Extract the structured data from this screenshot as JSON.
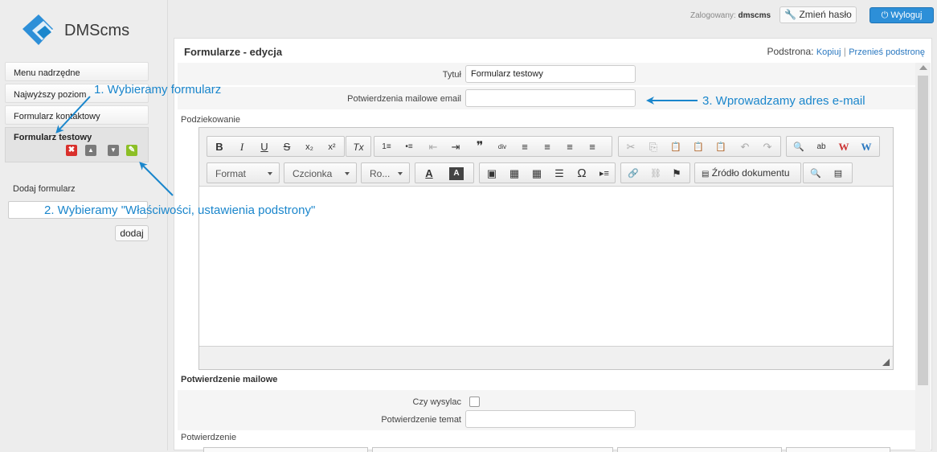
{
  "brand": {
    "name": "DMScms",
    "colors": {
      "accent": "#2d8fd8",
      "annotation": "#1a86cc",
      "delete": "#d9302c",
      "edit": "#8cbf26"
    }
  },
  "topbar": {
    "logged_label": "Zalogowany:",
    "username": "dmscms",
    "change_password": "Zmień hasło",
    "logout": "Wyloguj"
  },
  "sidebar": {
    "items": [
      {
        "label": "Menu nadrzędne"
      },
      {
        "label": "Najwyższy poziom"
      },
      {
        "label": "Formularz kontaktowy"
      }
    ],
    "active": {
      "label": "Formularz testowy",
      "actions": [
        {
          "icon": "delete-icon",
          "glyph": "✖"
        },
        {
          "icon": "move-up-icon",
          "glyph": "▲"
        },
        {
          "icon": "move-down-icon",
          "glyph": "▼"
        },
        {
          "icon": "properties-icon",
          "glyph": "✎"
        }
      ]
    },
    "add_label": "Dodaj formularz",
    "add_input_value": "",
    "add_button": "dodaj"
  },
  "panel": {
    "title": "Formularze - edycja",
    "subpage_label": "Podstrona:",
    "copy_link": "Kopiuj",
    "separator": "|",
    "move_link": "Przenieś podstronę"
  },
  "form": {
    "title_label": "Tytuł",
    "title_value": "Formularz testowy",
    "email_label": "Potwierdzenia mailowe email",
    "email_value": "",
    "thanks_label": "Podziekowanie",
    "section_mail": "Potwierdzenie mailowe",
    "send_label": "Czy wysylac",
    "send_checked": false,
    "subject_label": "Potwierdzenie temat",
    "subject_value": "",
    "confirm_label": "Potwierdzenie"
  },
  "editor": {
    "format_combo": "Format",
    "font_combo": "Czcionka",
    "size_combo": "Ro...",
    "source_button": "Źródło dokumentu",
    "row1_glyphs": [
      "B",
      "I",
      "U",
      "S",
      "x₂",
      "x²",
      "Tx",
      "1≡",
      "•≡",
      "⇤",
      "⇥",
      "❞",
      "div",
      "≡",
      "≡",
      "≡",
      "≡",
      "✂",
      "⎘",
      "📋",
      "📋",
      "📋",
      "↶",
      "↷",
      "🔍",
      "ab",
      "W",
      "W"
    ],
    "row2_glyphs": [
      "A",
      "A",
      "▣",
      "▦",
      "▦",
      "☰",
      "Ω",
      "▸≡",
      "🔗",
      "⛓",
      "⚑",
      "🔍",
      "▤"
    ]
  },
  "annotations": {
    "step1": "1. Wybieramy formularz",
    "step2": "2. Wybieramy \"Właściwości, ustawienia podstrony\"",
    "step3": "3. Wprowadzamy adres e-mail"
  }
}
